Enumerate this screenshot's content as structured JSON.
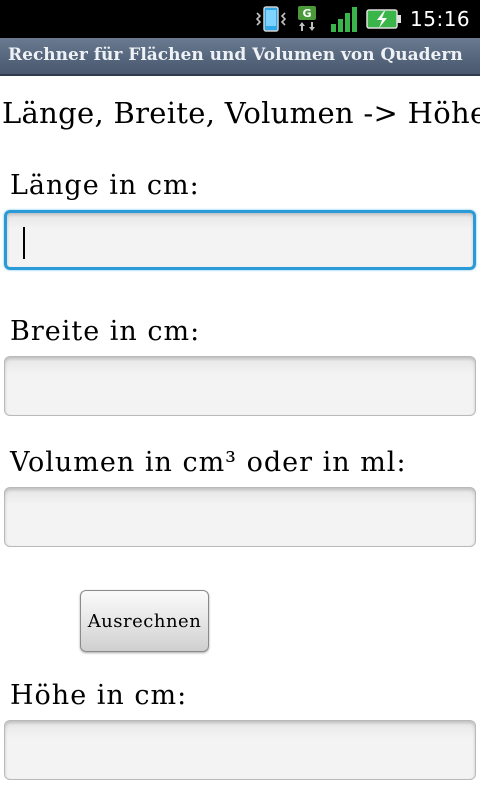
{
  "status_bar": {
    "time": "15:16",
    "icons": [
      "vibrate-icon",
      "data-g-icon",
      "signal-icon",
      "battery-charging-icon"
    ],
    "data_network_label": "G"
  },
  "app": {
    "title": "Rechner für Flächen und Volumen von Quadern"
  },
  "form": {
    "heading": "Länge, Breite, Volumen -> Höhe",
    "length_label": "Länge in cm:",
    "length_value": "",
    "width_label": "Breite in cm:",
    "width_value": "",
    "volume_label": "Volumen in cm³ oder in ml:",
    "volume_value": "",
    "calculate_label": "Ausrechnen",
    "height_label": "Höhe in cm:",
    "height_value": ""
  },
  "colors": {
    "focus_border": "#2b9ad6",
    "title_bar": "#56667c",
    "battery_green": "#39b54a"
  }
}
